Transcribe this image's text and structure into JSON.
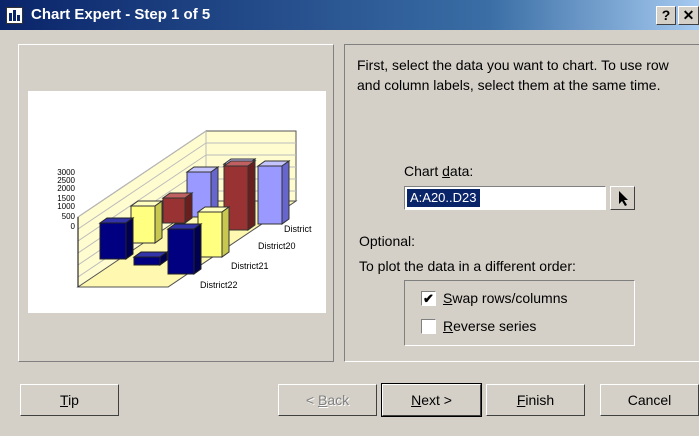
{
  "window": {
    "title": "Chart Expert - Step 1 of 5",
    "help_button": "?",
    "close_button": "✕"
  },
  "preview_chart": {
    "y_ticks": [
      "3000",
      "2500",
      "2000",
      "1500",
      "1000",
      "500",
      "0"
    ],
    "series_labels": [
      "District",
      "District20",
      "District21",
      "District22"
    ]
  },
  "instructions": "First, select the data you want to chart. To use row and column labels, select them at the same time.",
  "chart_data_field": {
    "label_pre": "Chart ",
    "label_accel": "d",
    "label_post": "ata:",
    "value": "A:A20..D23"
  },
  "optional": {
    "heading": "Optional:",
    "subheading": "To plot the data in a different order:",
    "swap": {
      "accel": "S",
      "rest": "wap rows/columns",
      "checked": true,
      "check_mark": "✔"
    },
    "reverse": {
      "accel": "R",
      "rest": "everse series",
      "checked": false
    }
  },
  "buttons": {
    "tip": {
      "accel": "T",
      "rest": "ip"
    },
    "back": {
      "pre": "< ",
      "accel": "B",
      "rest": "ack"
    },
    "next": {
      "accel": "N",
      "rest": "ext >"
    },
    "finish": {
      "accel": "F",
      "rest": "inish"
    },
    "cancel": {
      "label": "Cancel"
    }
  },
  "colors": {
    "title_gradient_start": "#0a246a",
    "title_gradient_end": "#a6caf0",
    "dialog_face": "#d4d0c8",
    "bar_navy": "#000080",
    "bar_yellow": "#ffff80",
    "bar_maroon": "#993333",
    "bar_lavender": "#9999ff",
    "chart_wall": "#fffccc"
  }
}
